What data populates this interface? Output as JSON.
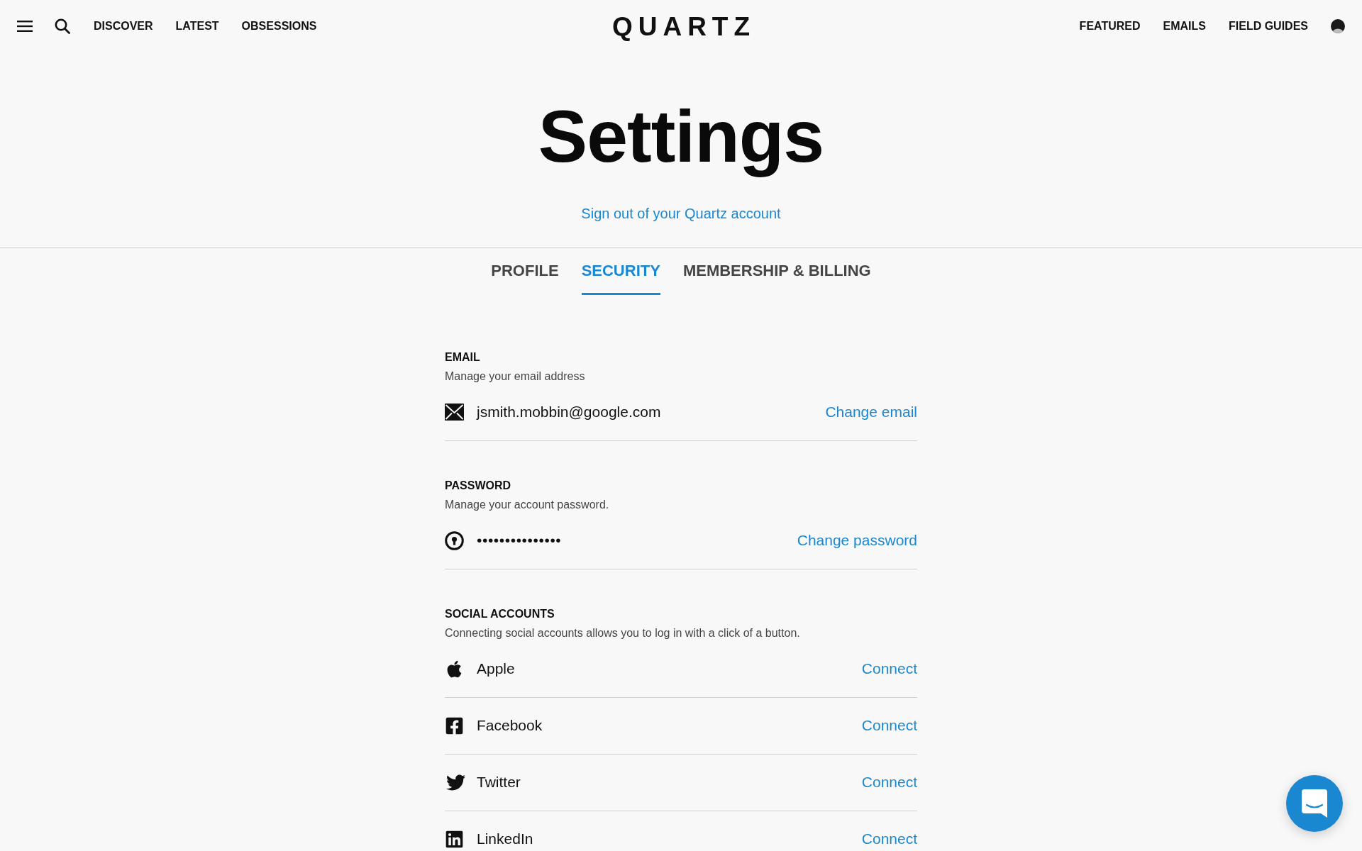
{
  "header": {
    "nav_left": [
      "DISCOVER",
      "LATEST",
      "OBSESSIONS"
    ],
    "logo": "QUARTZ",
    "nav_right": [
      "FEATURED",
      "EMAILS",
      "FIELD GUIDES"
    ]
  },
  "title": "Settings",
  "sign_out_link": "Sign out of your Quartz account",
  "tabs": [
    {
      "label": "PROFILE",
      "selected": false
    },
    {
      "label": "SECURITY",
      "selected": true
    },
    {
      "label": "MEMBERSHIP & BILLING",
      "selected": false
    }
  ],
  "sections": [
    {
      "heading": "EMAIL",
      "description": "Manage your email address",
      "rows": [
        {
          "kind": "email",
          "value": "jsmith.mobbin@google.com",
          "action": "Change email"
        }
      ]
    },
    {
      "heading": "PASSWORD",
      "description": "Manage your account password.",
      "rows": [
        {
          "kind": "password",
          "value": "•••••••••••••••",
          "action": "Change password"
        }
      ]
    },
    {
      "heading": "SOCIAL ACCOUNTS",
      "description": "Connecting social accounts allows you to log in with a click of a button.",
      "rows": [
        {
          "kind": "apple",
          "value": "Apple",
          "action": "Connect"
        },
        {
          "kind": "facebook",
          "value": "Facebook",
          "action": "Connect"
        },
        {
          "kind": "twitter",
          "value": "Twitter",
          "action": "Connect"
        },
        {
          "kind": "linkedin",
          "value": "LinkedIn",
          "action": "Connect"
        }
      ]
    }
  ]
}
